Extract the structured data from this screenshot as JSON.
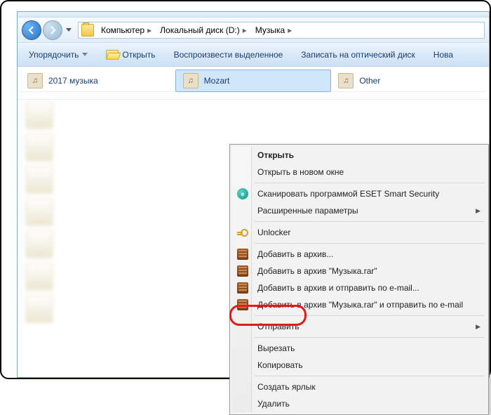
{
  "breadcrumb": {
    "items": [
      {
        "label": "Компьютер"
      },
      {
        "label": "Локальный диск (D:)"
      },
      {
        "label": "Музыка"
      }
    ]
  },
  "toolbar": {
    "organize": "Упорядочить",
    "open": "Открыть",
    "play": "Воспроизвести выделенное",
    "burn": "Записать на оптический диск",
    "newf": "Нова"
  },
  "groups": [
    {
      "name": "2017 музыка"
    },
    {
      "name": "Mozart"
    },
    {
      "name": "Other"
    }
  ],
  "sidebar_items": [
    {
      "name": ""
    },
    {
      "name": ""
    },
    {
      "name": ""
    },
    {
      "name": ""
    },
    {
      "name": ""
    },
    {
      "name": ""
    },
    {
      "name": ""
    }
  ],
  "context_menu": {
    "open": "Открыть",
    "open_new": "Открыть в новом окне",
    "scan_eset": "Сканировать программой ESET Smart Security",
    "advanced": "Расширенные параметры",
    "unlocker": "Unlocker",
    "add_archive": "Добавить в архив...",
    "add_archive_name": "Добавить в архив \"Музыка.rar\"",
    "add_email": "Добавить в архив и отправить по e-mail...",
    "add_name_email": "Добавить в архив \"Музыка.rar\" и отправить по e-mail",
    "send_to": "Отправить",
    "cut": "Вырезать",
    "copy": "Копировать",
    "shortcut": "Создать ярлык",
    "delete": "Удалить"
  }
}
